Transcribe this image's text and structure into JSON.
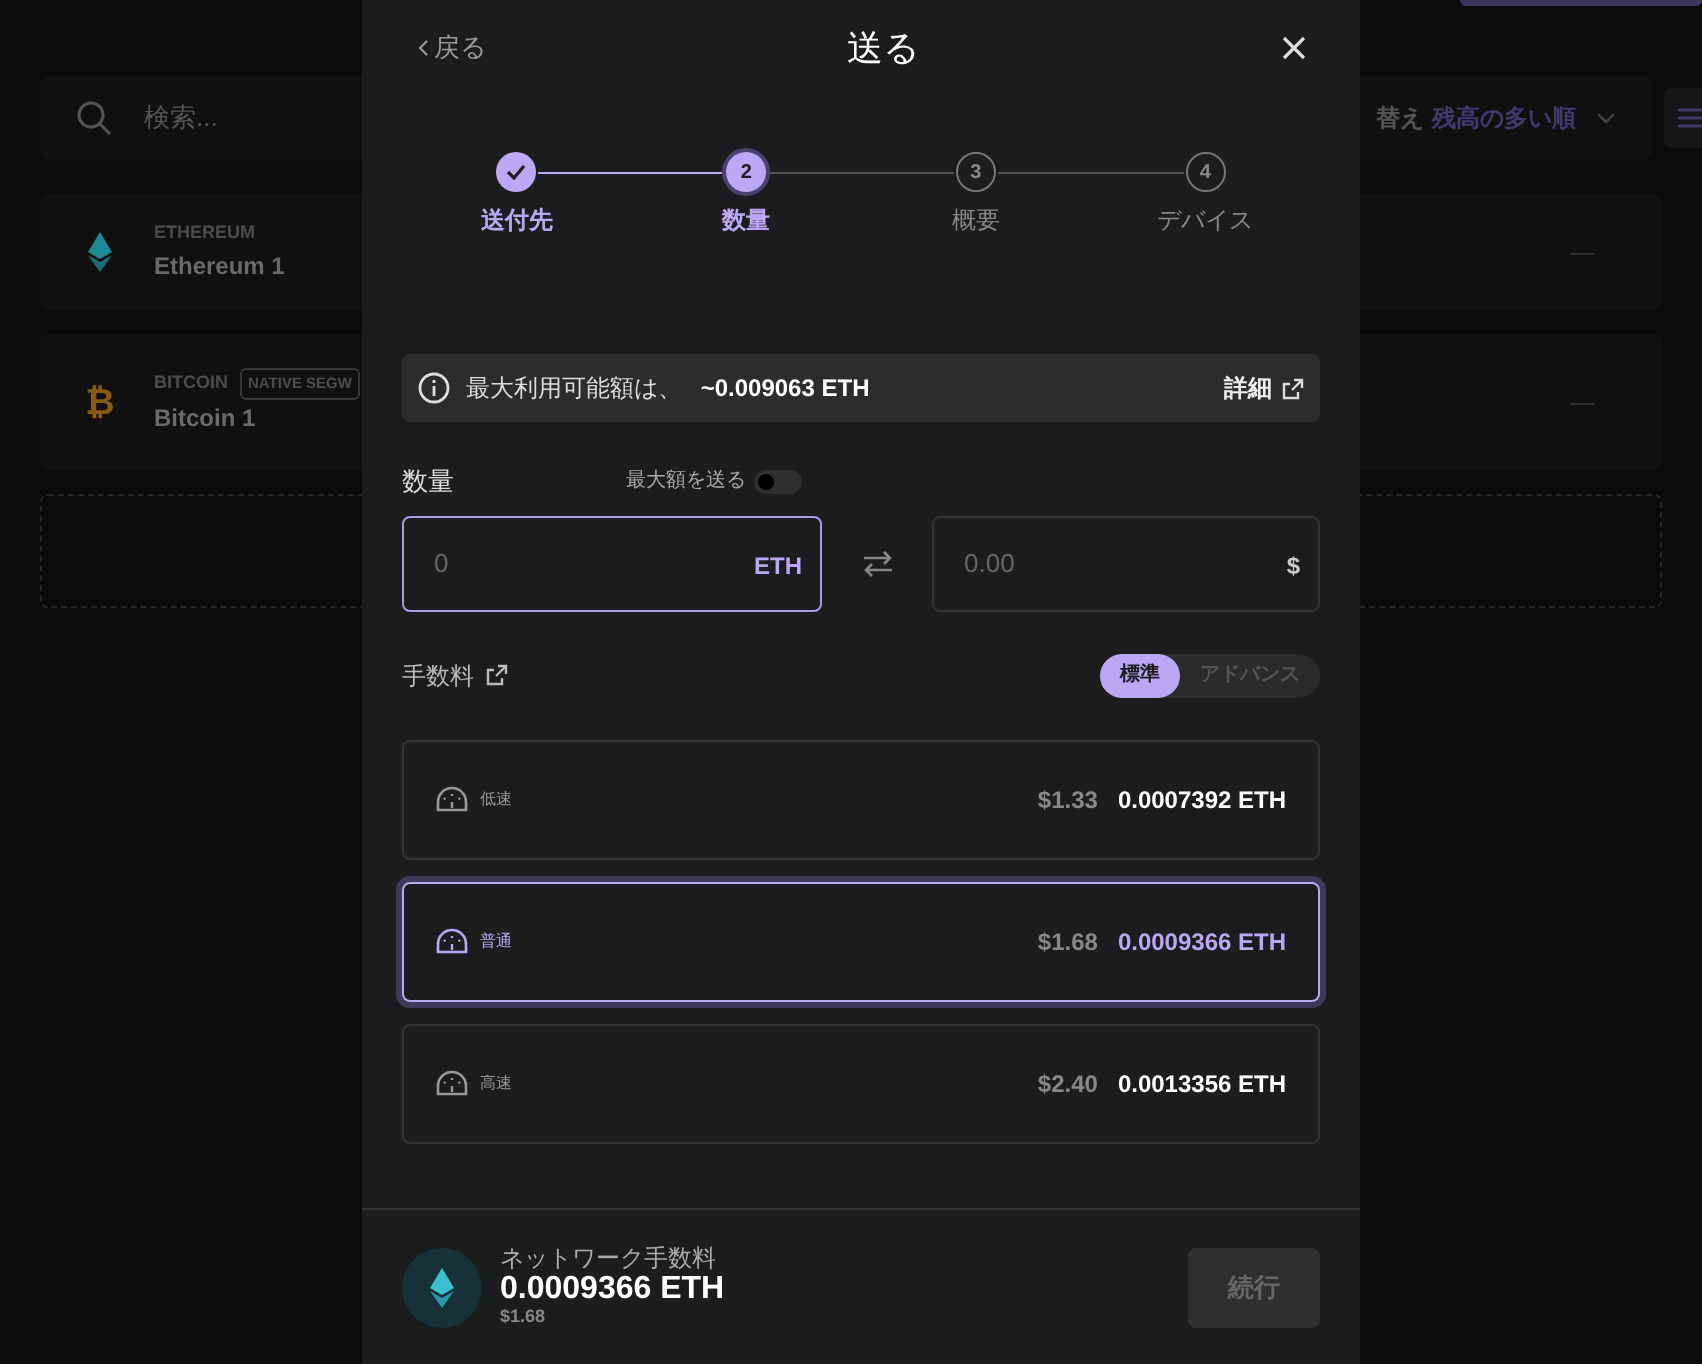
{
  "background": {
    "search": {
      "placeholder": "検索..."
    },
    "sort": {
      "label": "替え",
      "value": "残高の多い順"
    },
    "accounts": [
      {
        "kind": "eth",
        "currency": "ETHEREUM",
        "name": "Ethereum 1",
        "balance": "—"
      },
      {
        "kind": "btc",
        "symbol": "₿",
        "currency": "BITCOIN",
        "tag": "NATIVE SEGW",
        "name": "Bitcoin 1",
        "balance": "—"
      }
    ]
  },
  "modal": {
    "back": "戻る",
    "title": "送る",
    "steps": [
      {
        "label": "送付先",
        "completed": true,
        "selected": false
      },
      {
        "label": "数量",
        "number": "2",
        "completed": false,
        "selected": true
      },
      {
        "label": "概要",
        "number": "3",
        "completed": false,
        "selected": false
      },
      {
        "label": "デバイス",
        "number": "4",
        "completed": false,
        "selected": false
      }
    ],
    "info": {
      "text": "最大利用可能額は、 **~0.009063 ETH**",
      "link": "詳細"
    },
    "amount": {
      "label": "数量",
      "max_toggle": {
        "label": "最大額を送る",
        "on": false
      },
      "crypto": {
        "placeholder": "0",
        "unit": "ETH"
      },
      "fiat": {
        "placeholder": "0.00",
        "unit": "$"
      }
    },
    "fees": {
      "label": "手数料",
      "modes": [
        {
          "label": "標準",
          "selected": true
        },
        {
          "label": "アドバンス",
          "selected": false
        }
      ],
      "options": [
        {
          "label": "低速",
          "fiat": "$1.33",
          "crypto": "0.0007392 ETH",
          "selected": false
        },
        {
          "label": "普通",
          "fiat": "$1.68",
          "crypto": "0.0009366 ETH",
          "selected": true
        },
        {
          "label": "高速",
          "fiat": "$2.40",
          "crypto": "0.0013356 ETH",
          "selected": false
        }
      ]
    },
    "footer": {
      "label": "ネットワーク手数料",
      "amount": "0.0009366 ETH",
      "fiat": "$1.68",
      "button": {
        "label": "続行",
        "disabled": true
      }
    }
  }
}
